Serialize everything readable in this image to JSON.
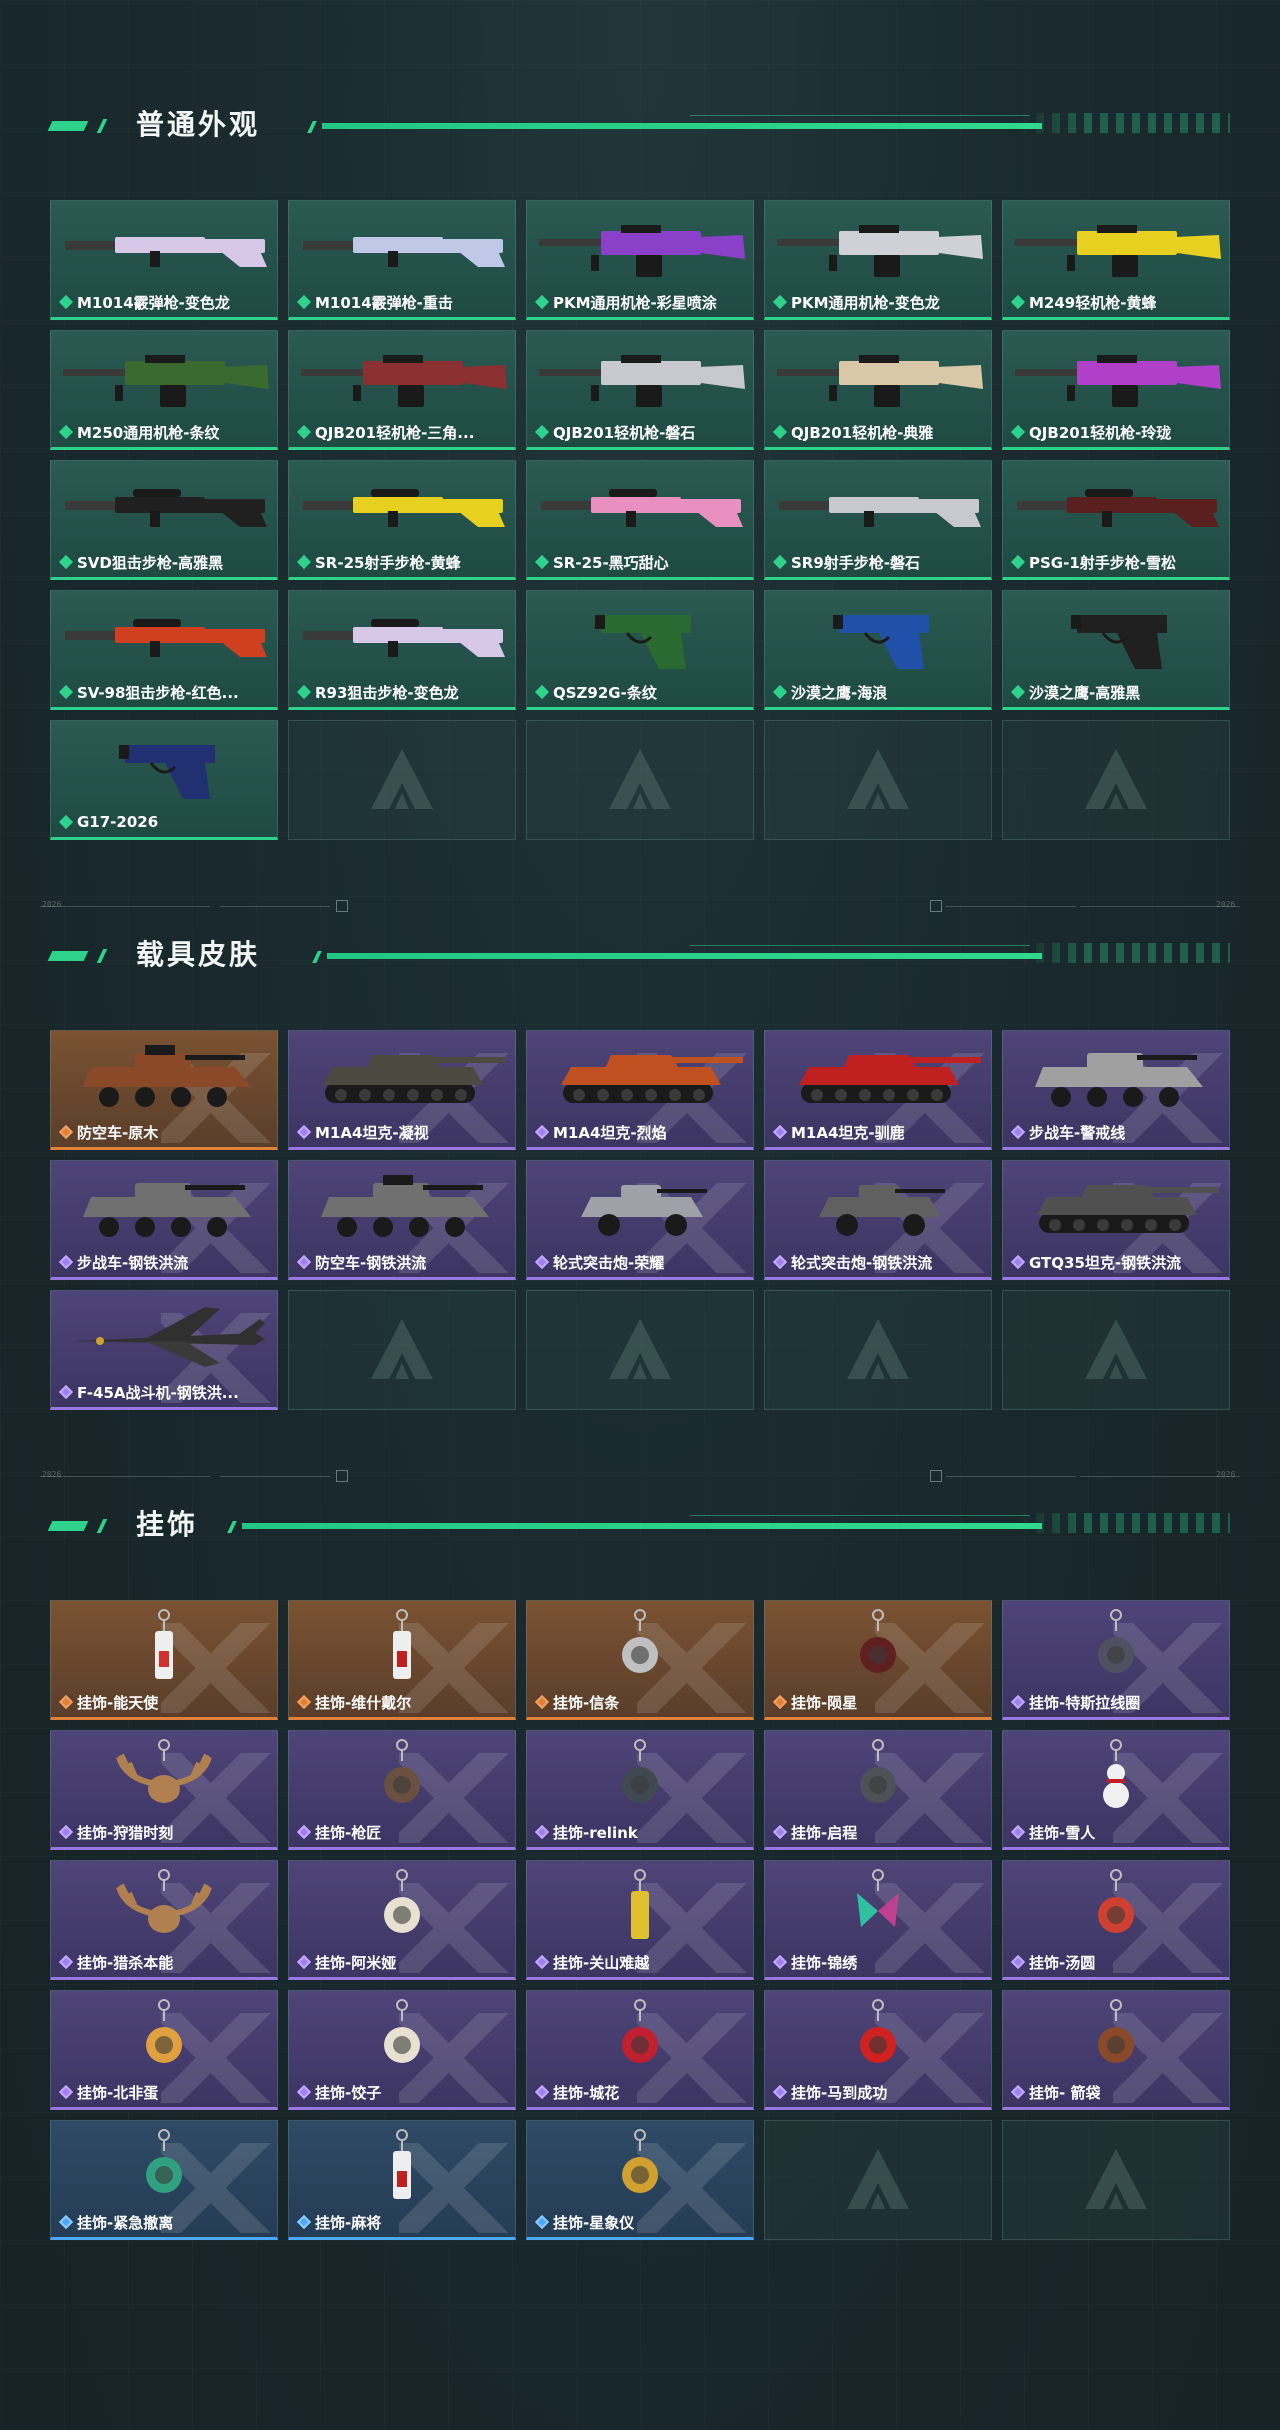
{
  "sections": {
    "weapons": {
      "title": "普通外观"
    },
    "vehicles": {
      "title": "载具皮肤"
    },
    "charms": {
      "title": "挂饰"
    }
  },
  "divider_code": "2026",
  "weapons": [
    {
      "name": "M1014霰弹枪-变色龙",
      "rarity": "green",
      "icon": "shotgun-icon",
      "color": "#d8c8e8"
    },
    {
      "name": "M1014霰弹枪-重击",
      "rarity": "green",
      "icon": "shotgun-icon",
      "color": "#c0c8e8"
    },
    {
      "name": "PKM通用机枪-彩星喷涂",
      "rarity": "green",
      "icon": "machine-gun-icon",
      "color": "#8a40c8"
    },
    {
      "name": "PKM通用机枪-变色龙",
      "rarity": "green",
      "icon": "machine-gun-icon",
      "color": "#d0d0d8"
    },
    {
      "name": "M249轻机枪-黄蜂",
      "rarity": "green",
      "icon": "machine-gun-icon",
      "color": "#e8d020"
    },
    {
      "name": "M250通用机枪-条纹",
      "rarity": "green",
      "icon": "machine-gun-icon",
      "color": "#3a6a30"
    },
    {
      "name": "QJB201轻机枪-三角...",
      "rarity": "green",
      "icon": "machine-gun-icon",
      "color": "#8a3030"
    },
    {
      "name": "QJB201轻机枪-磐石",
      "rarity": "green",
      "icon": "machine-gun-icon",
      "color": "#c8c8d0"
    },
    {
      "name": "QJB201轻机枪-典雅",
      "rarity": "green",
      "icon": "machine-gun-icon",
      "color": "#d8c8a8"
    },
    {
      "name": "QJB201轻机枪-玲珑",
      "rarity": "green",
      "icon": "machine-gun-icon",
      "color": "#b040c8"
    },
    {
      "name": "SVD狙击步枪-高雅黑",
      "rarity": "green",
      "icon": "sniper-rifle-icon",
      "color": "#202020"
    },
    {
      "name": "SR-25射手步枪-黄蜂",
      "rarity": "green",
      "icon": "sniper-rifle-icon",
      "color": "#e8d020"
    },
    {
      "name": "SR-25-黑巧甜心",
      "rarity": "green",
      "icon": "sniper-rifle-icon",
      "color": "#e890c0"
    },
    {
      "name": "SR9射手步枪-磐石",
      "rarity": "green",
      "icon": "rifle-icon",
      "color": "#c8c8d0"
    },
    {
      "name": "PSG-1射手步枪-雪松",
      "rarity": "green",
      "icon": "sniper-rifle-icon",
      "color": "#5a2020"
    },
    {
      "name": "SV-98狙击步枪-红色...",
      "rarity": "green",
      "icon": "sniper-rifle-icon",
      "color": "#d04020"
    },
    {
      "name": "R93狙击步枪-变色龙",
      "rarity": "green",
      "icon": "sniper-rifle-icon",
      "color": "#d8c8e8"
    },
    {
      "name": "QSZ92G-条纹",
      "rarity": "green",
      "icon": "pistol-icon",
      "color": "#2a6a30"
    },
    {
      "name": "沙漠之鹰-海浪",
      "rarity": "green",
      "icon": "pistol-icon",
      "color": "#2050a8"
    },
    {
      "name": "沙漠之鹰-高雅黑",
      "rarity": "green",
      "icon": "pistol-icon",
      "color": "#202020"
    },
    {
      "name": "G17-2026",
      "rarity": "green",
      "icon": "pistol-icon",
      "color": "#203070"
    },
    {
      "empty": true
    },
    {
      "empty": true
    },
    {
      "empty": true
    },
    {
      "empty": true
    }
  ],
  "vehicles": [
    {
      "name": "防空车-原木",
      "rarity": "orange",
      "icon": "anti-air-vehicle-icon",
      "color": "#8a4a2a"
    },
    {
      "name": "M1A4坦克-凝视",
      "rarity": "purple",
      "icon": "tank-icon",
      "color": "#4a4a40"
    },
    {
      "name": "M1A4坦克-烈焰",
      "rarity": "purple",
      "icon": "tank-icon",
      "color": "#c05020"
    },
    {
      "name": "M1A4坦克-驯鹿",
      "rarity": "purple",
      "icon": "tank-icon",
      "color": "#c02020"
    },
    {
      "name": "步战车-警戒线",
      "rarity": "purple",
      "icon": "ifv-icon",
      "color": "#a0a0a0"
    },
    {
      "name": "步战车-钢铁洪流",
      "rarity": "purple",
      "icon": "ifv-icon",
      "color": "#707070"
    },
    {
      "name": "防空车-钢铁洪流",
      "rarity": "purple",
      "icon": "anti-air-vehicle-icon",
      "color": "#707070"
    },
    {
      "name": "轮式突击炮-荣耀",
      "rarity": "purple",
      "icon": "assault-vehicle-icon",
      "color": "#a0a0a8"
    },
    {
      "name": "轮式突击炮-钢铁洪流",
      "rarity": "purple",
      "icon": "assault-vehicle-icon",
      "color": "#606060"
    },
    {
      "name": "GTQ35坦克-钢铁洪流",
      "rarity": "purple",
      "icon": "tank-icon",
      "color": "#505050"
    },
    {
      "name": "F-45A战斗机-钢铁洪...",
      "rarity": "purple",
      "icon": "fighter-jet-icon",
      "color": "#303030"
    },
    {
      "empty": true
    },
    {
      "empty": true
    },
    {
      "empty": true
    },
    {
      "empty": true
    }
  ],
  "charms": [
    {
      "name": "挂饰-能天使",
      "rarity": "orange",
      "icon": "charm-tag-icon",
      "color": "#d03030"
    },
    {
      "name": "挂饰-维什戴尔",
      "rarity": "orange",
      "icon": "charm-tag-icon",
      "color": "#c02020"
    },
    {
      "name": "挂饰-信条",
      "rarity": "orange",
      "icon": "charm-figure-icon",
      "color": "#c0c0c0"
    },
    {
      "name": "挂饰-陨星",
      "rarity": "orange",
      "icon": "charm-bird-icon",
      "color": "#602020"
    },
    {
      "name": "挂饰-特斯拉线圈",
      "rarity": "purple",
      "icon": "charm-coil-icon",
      "color": "#505060"
    },
    {
      "name": "挂饰-狩猎时刻",
      "rarity": "purple",
      "icon": "charm-antler-icon",
      "color": "#b08050"
    },
    {
      "name": "挂饰-枪匠",
      "rarity": "purple",
      "icon": "charm-pouch-icon",
      "color": "#6a5040"
    },
    {
      "name": "挂饰-relink",
      "rarity": "purple",
      "icon": "charm-shield-icon",
      "color": "#404850"
    },
    {
      "name": "挂饰-启程",
      "rarity": "purple",
      "icon": "charm-badge-icon",
      "color": "#505058"
    },
    {
      "name": "挂饰-雪人",
      "rarity": "purple",
      "icon": "charm-snowman-icon",
      "color": "#f0f0f0"
    },
    {
      "name": "挂饰-猎杀本能",
      "rarity": "purple",
      "icon": "charm-antler-icon",
      "color": "#b08050"
    },
    {
      "name": "挂饰-阿米娅",
      "rarity": "purple",
      "icon": "charm-bunny-icon",
      "color": "#e8e0d0"
    },
    {
      "name": "挂饰-关山难越",
      "rarity": "purple",
      "icon": "charm-bar-icon",
      "color": "#e0c030"
    },
    {
      "name": "挂饰-锦绣",
      "rarity": "purple",
      "icon": "charm-butterfly-icon",
      "color": "#30c0a0"
    },
    {
      "name": "挂饰-汤圆",
      "rarity": "purple",
      "icon": "charm-bowl-icon",
      "color": "#d04030"
    },
    {
      "name": "挂饰-北非蛋",
      "rarity": "purple",
      "icon": "charm-food-icon",
      "color": "#e0a040"
    },
    {
      "name": "挂饰-饺子",
      "rarity": "purple",
      "icon": "charm-plate-icon",
      "color": "#e8e0d0"
    },
    {
      "name": "挂饰-城花",
      "rarity": "purple",
      "icon": "charm-flower-icon",
      "color": "#c02030"
    },
    {
      "name": "挂饰-马到成功",
      "rarity": "purple",
      "icon": "charm-horse-icon",
      "color": "#d02020"
    },
    {
      "name": "挂饰- 箭袋",
      "rarity": "purple",
      "icon": "charm-quiver-icon",
      "color": "#8a4a2a"
    },
    {
      "name": "挂饰-紧急撤离",
      "rarity": "blue",
      "icon": "charm-box-icon",
      "color": "#30a080"
    },
    {
      "name": "挂饰-麻将",
      "rarity": "blue",
      "icon": "charm-mahjong-icon",
      "color": "#f0f0f0"
    },
    {
      "name": "挂饰-星象仪",
      "rarity": "blue",
      "icon": "charm-astrolabe-icon",
      "color": "#d0a030"
    },
    {
      "empty": true
    },
    {
      "empty": true
    }
  ]
}
